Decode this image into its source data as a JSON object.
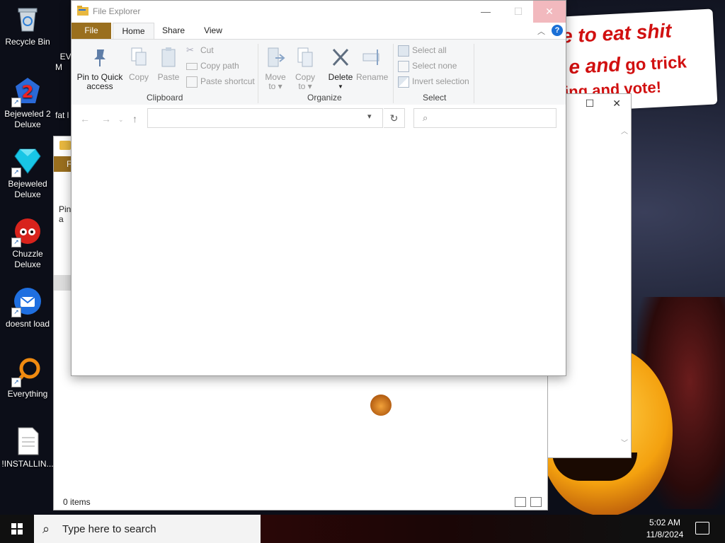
{
  "desktop": {
    "banner": {
      "line1": "e to eat shit",
      "line2a": "e and",
      "line2b": " go trick",
      "line3": "ing and vote!"
    },
    "icons": [
      {
        "label": "Recycle Bin",
        "icon": "recycle-bin-icon"
      },
      {
        "label": "Bejeweled 2 Deluxe",
        "icon": "bejeweled-2-icon"
      },
      {
        "label": "Bejeweled Deluxe",
        "icon": "bejeweled-icon"
      },
      {
        "label": "Chuzzle Deluxe",
        "icon": "chuzzle-icon"
      },
      {
        "label": "doesnt load",
        "icon": "thunderbird-icon"
      },
      {
        "label": "Everything",
        "icon": "everything-search-icon"
      },
      {
        "label": "!INSTALLIN...",
        "icon": "text-file-icon"
      }
    ],
    "partial_icons": [
      {
        "label": "EV\nM"
      },
      {
        "label": "fat l"
      }
    ]
  },
  "background_window_1": {
    "tab_label": "F",
    "pin_label": "Pin\na",
    "status": "0 items"
  },
  "explorer": {
    "title": "File Explorer",
    "tabs": [
      "File",
      "Home",
      "Share",
      "View"
    ],
    "ribbon": {
      "clipboard": {
        "label": "Clipboard",
        "pin": "Pin to Quick access",
        "copy": "Copy",
        "paste": "Paste",
        "cut": "Cut",
        "copy_path": "Copy path",
        "paste_shortcut": "Paste shortcut"
      },
      "organize": {
        "label": "Organize",
        "move_to": "Move to",
        "copy_to": "Copy to",
        "delete": "Delete",
        "rename": "Rename"
      },
      "select": {
        "label": "Select",
        "select_all": "Select all",
        "select_none": "Select none",
        "invert": "Invert selection"
      }
    },
    "address_value": "",
    "search_placeholder": ""
  },
  "taskbar": {
    "search_placeholder": "Type here to search",
    "time": "5:02 AM",
    "date": "11/8/2024"
  },
  "colors": {
    "file_tab": "#9a6f1e",
    "help_badge": "#1a6fd6",
    "banner_text": "#d11010",
    "close_hover": "#f2b9be"
  }
}
